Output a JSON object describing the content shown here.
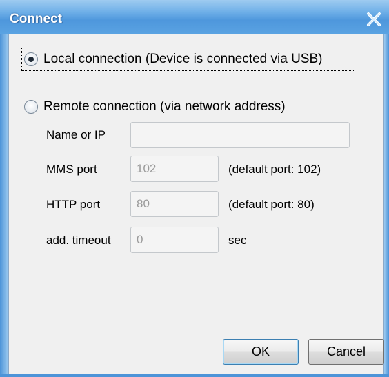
{
  "window": {
    "title": "Connect",
    "close_label": "Close"
  },
  "connection": {
    "local_label": "Local connection (Device is connected via USB)",
    "local_checked": true,
    "remote_label": "Remote connection (via network address)",
    "remote_checked": false
  },
  "remote": {
    "name_label": "Name or IP",
    "name_value": "",
    "mms_label": "MMS port",
    "mms_value": "102",
    "mms_hint": "(default port: 102)",
    "http_label": "HTTP port",
    "http_value": "80",
    "http_hint": "(default port: 80)",
    "timeout_label": "add. timeout",
    "timeout_value": "0",
    "timeout_unit": "sec"
  },
  "buttons": {
    "ok": "OK",
    "cancel": "Cancel"
  },
  "colors": {
    "titlebar": "#5aa3e2",
    "client_background": "#f0f0f0",
    "default_button_border": "#3c7fb1"
  }
}
